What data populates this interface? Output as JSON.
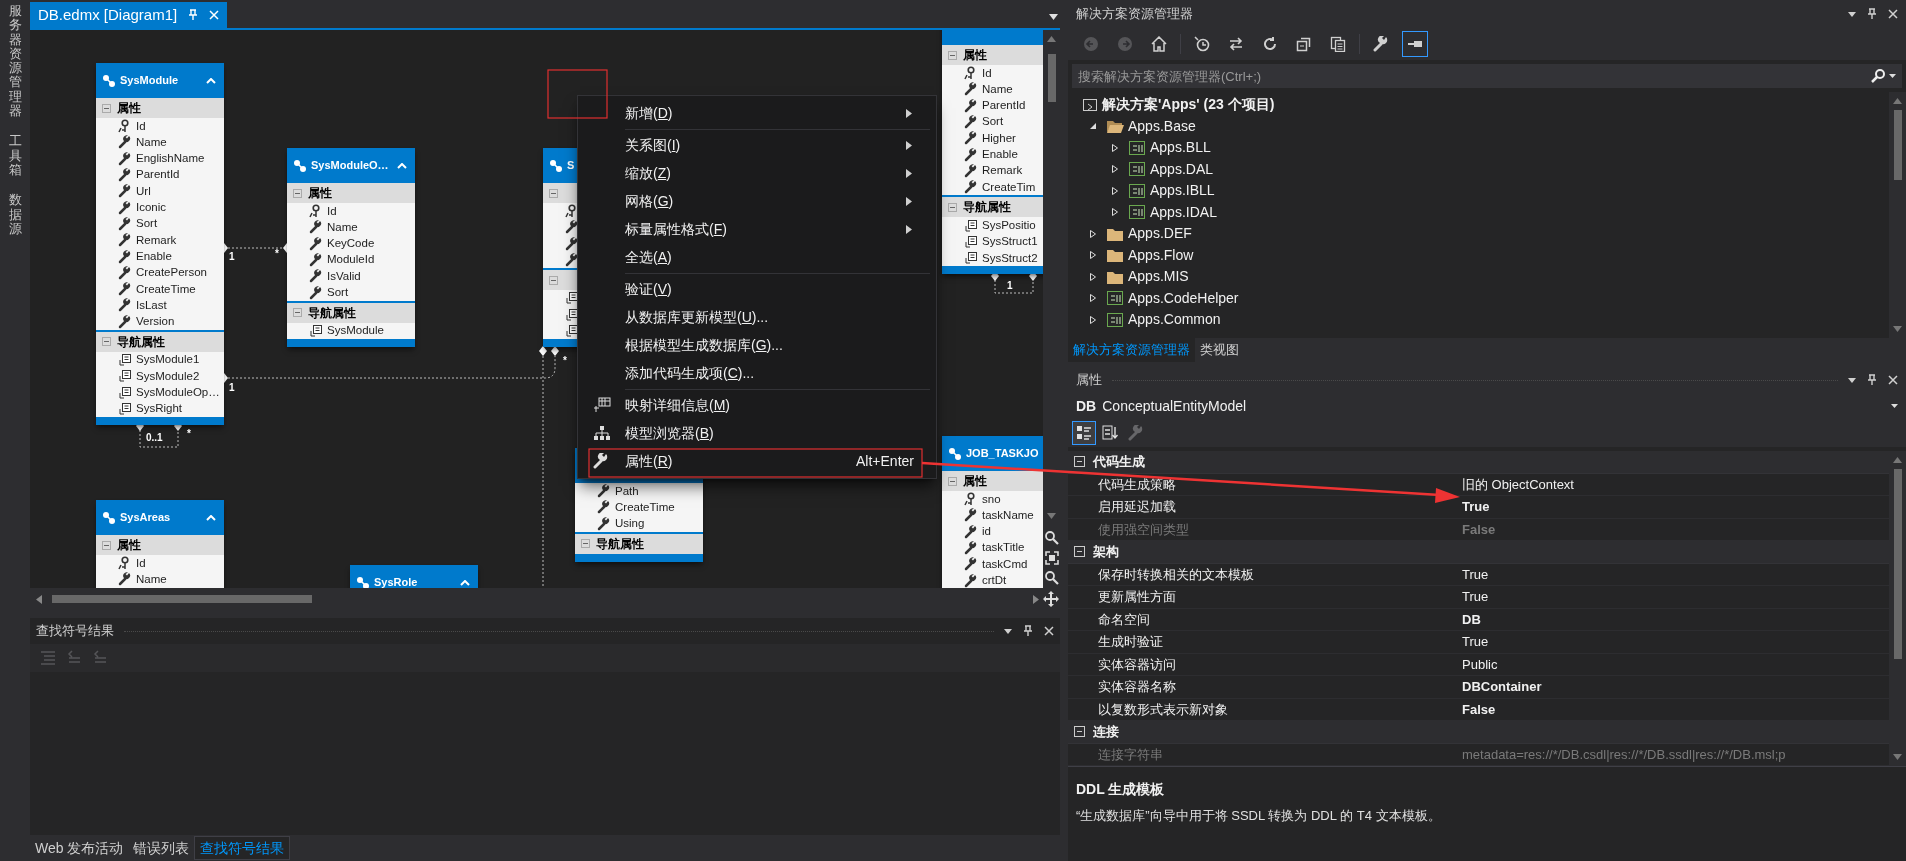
{
  "side_tabs": [
    "服务器资源管理器",
    "工具箱",
    "数据源"
  ],
  "document_tab": {
    "title": "DB.edmx [Diagram1]",
    "selected": true
  },
  "diagram": {
    "entities": [
      {
        "name": "SysModule",
        "sections": [
          {
            "label": "属性",
            "rows": [
              {
                "name": "Id",
                "kind": "key"
              },
              {
                "name": "Name",
                "kind": "property"
              },
              {
                "name": "EnglishName",
                "kind": "property"
              },
              {
                "name": "ParentId",
                "kind": "property"
              },
              {
                "name": "Url",
                "kind": "property"
              },
              {
                "name": "Iconic",
                "kind": "property"
              },
              {
                "name": "Sort",
                "kind": "property"
              },
              {
                "name": "Remark",
                "kind": "property"
              },
              {
                "name": "Enable",
                "kind": "property"
              },
              {
                "name": "CreatePerson",
                "kind": "property"
              },
              {
                "name": "CreateTime",
                "kind": "property"
              },
              {
                "name": "IsLast",
                "kind": "property"
              },
              {
                "name": "Version",
                "kind": "property"
              }
            ]
          },
          {
            "label": "导航属性",
            "rows": [
              {
                "name": "SysModule1",
                "kind": "navigation"
              },
              {
                "name": "SysModule2",
                "kind": "navigation"
              },
              {
                "name": "SysModuleOp…",
                "kind": "navigation"
              },
              {
                "name": "SysRight",
                "kind": "navigation"
              }
            ]
          }
        ]
      },
      {
        "name": "SysAreas",
        "sections": [
          {
            "label": "属性",
            "rows": [
              {
                "name": "Id",
                "kind": "key"
              },
              {
                "name": "Name",
                "kind": "property"
              }
            ]
          }
        ]
      },
      {
        "name": "SysModuleO…",
        "sections": [
          {
            "label": "属性",
            "rows": [
              {
                "name": "Id",
                "kind": "key"
              },
              {
                "name": "Name",
                "kind": "property"
              },
              {
                "name": "KeyCode",
                "kind": "property"
              },
              {
                "name": "ModuleId",
                "kind": "property"
              },
              {
                "name": "IsValid",
                "kind": "property"
              },
              {
                "name": "Sort",
                "kind": "property"
              }
            ]
          },
          {
            "label": "导航属性",
            "rows": [
              {
                "name": "SysModule",
                "kind": "navigation"
              }
            ]
          }
        ]
      },
      {
        "name": "SysRole"
      },
      {
        "name": "S",
        "sections": [
          {
            "rows": [
              {
                "kind": "key"
              },
              {
                "kind": "property"
              },
              {
                "kind": "property"
              },
              {
                "kind": "property"
              }
            ]
          },
          {
            "rows": [
              {
                "kind": "navigation"
              },
              {
                "kind": "navigation"
              },
              {
                "kind": "navigation"
              }
            ]
          }
        ]
      },
      {
        "sections": [
          {
            "rows": [
              {
                "name": "Path",
                "kind": "property"
              },
              {
                "name": "CreateTime",
                "kind": "property"
              },
              {
                "name": "Using",
                "kind": "property"
              }
            ]
          },
          {
            "label": "导航属性"
          }
        ]
      },
      {
        "sections": [
          {
            "label": "属性",
            "rows": [
              {
                "name": "Id",
                "kind": "key"
              },
              {
                "name": "Name",
                "kind": "property"
              },
              {
                "name": "ParentId",
                "kind": "property"
              },
              {
                "name": "Sort",
                "kind": "property"
              },
              {
                "name": "Higher",
                "kind": "property"
              },
              {
                "name": "Enable",
                "kind": "property"
              },
              {
                "name": "Remark",
                "kind": "property"
              },
              {
                "name": "CreateTim",
                "kind": "property"
              }
            ]
          },
          {
            "label": "导航属性",
            "rows": [
              {
                "name": "SysPositio",
                "kind": "navigation"
              },
              {
                "name": "SysStruct1",
                "kind": "navigation"
              },
              {
                "name": "SysStruct2",
                "kind": "navigation"
              }
            ]
          }
        ]
      },
      {
        "name": "JOB_TASKJO",
        "sections": [
          {
            "label": "属性",
            "rows": [
              {
                "name": "sno",
                "kind": "key"
              },
              {
                "name": "taskName",
                "kind": "property"
              },
              {
                "name": "id",
                "kind": "property"
              },
              {
                "name": "taskTitle",
                "kind": "property"
              },
              {
                "name": "taskCmd",
                "kind": "property"
              },
              {
                "name": "crtDt",
                "kind": "property"
              }
            ]
          }
        ]
      }
    ],
    "multiplicities": [
      "1",
      "*",
      "1",
      "*",
      "0..1",
      "*",
      "1"
    ]
  },
  "context_menu": {
    "items": [
      {
        "kind": "submenu",
        "label": "新增(D)"
      },
      {
        "kind": "separator"
      },
      {
        "kind": "submenu",
        "label": "关系图(I)"
      },
      {
        "kind": "submenu",
        "label": "缩放(Z)"
      },
      {
        "kind": "submenu",
        "label": "网格(G)"
      },
      {
        "kind": "submenu",
        "label": "标量属性格式(F)"
      },
      {
        "kind": "item",
        "label": "全选(A)"
      },
      {
        "kind": "separator"
      },
      {
        "kind": "item",
        "label": "验证(V)"
      },
      {
        "kind": "item",
        "label": "从数据库更新模型(U)..."
      },
      {
        "kind": "item",
        "label": "根据模型生成数据库(G)..."
      },
      {
        "kind": "item",
        "label": "添加代码生成项(C)..."
      },
      {
        "kind": "separator"
      },
      {
        "kind": "mapping",
        "label": "映射详细信息(M)"
      },
      {
        "kind": "browser",
        "label": "模型浏览器(B)"
      },
      {
        "kind": "properties",
        "label": "属性(R)",
        "shortcut": "Alt+Enter"
      }
    ]
  },
  "find_symbol_panel": {
    "title": "查找符号结果",
    "toolbar": [
      {
        "kind": "list",
        "disabled": true
      },
      {
        "kind": "previous",
        "disabled": true
      },
      {
        "kind": "next",
        "disabled": true
      }
    ]
  },
  "bottom_tabs": [
    {
      "label": "Web 发布活动",
      "selected": false
    },
    {
      "label": "错误列表",
      "selected": false
    },
    {
      "label": "查找符号结果",
      "selected": true
    }
  ],
  "solution_explorer": {
    "title": "解决方案资源管理器",
    "toolbar": [
      {
        "kind": "back",
        "disabled": true,
        "on": false
      },
      {
        "kind": "forward",
        "disabled": true,
        "on": false
      },
      {
        "kind": "home",
        "disabled": false,
        "on": false
      },
      {
        "kind": "separator"
      },
      {
        "kind": "history",
        "disabled": false,
        "on": false
      },
      {
        "kind": "sync",
        "disabled": false,
        "on": false
      },
      {
        "kind": "refresh",
        "disabled": false,
        "on": false
      },
      {
        "kind": "collapse",
        "disabled": false,
        "on": false
      },
      {
        "kind": "show-all",
        "disabled": false,
        "on": false
      },
      {
        "kind": "separator"
      },
      {
        "kind": "properties",
        "disabled": false,
        "on": false
      },
      {
        "kind": "preview",
        "disabled": false,
        "on": true
      }
    ],
    "search": {
      "placeholder": "搜索解决方案资源管理器(Ctrl+;)"
    },
    "tree": [
      {
        "kind": "solution",
        "label": "解决方案'Apps' (23 个项目)",
        "children": [
          {
            "kind": "folder",
            "label": "Apps.Base",
            "expanded": true,
            "children": [
              {
                "kind": "csproj",
                "label": "Apps.BLL",
                "expanded": false
              },
              {
                "kind": "csproj",
                "label": "Apps.DAL",
                "expanded": false
              },
              {
                "kind": "csproj",
                "label": "Apps.IBLL",
                "expanded": false
              },
              {
                "kind": "csproj",
                "label": "Apps.IDAL",
                "expanded": false
              }
            ]
          },
          {
            "kind": "folder",
            "label": "Apps.DEF",
            "expanded": false
          },
          {
            "kind": "folder",
            "label": "Apps.Flow",
            "expanded": false
          },
          {
            "kind": "folder",
            "label": "Apps.MIS",
            "expanded": false
          },
          {
            "kind": "csproj",
            "label": "Apps.CodeHelper",
            "expanded": false
          },
          {
            "kind": "csproj",
            "label": "Apps.Common",
            "expanded": false
          }
        ]
      }
    ],
    "tabs": [
      {
        "label": "解决方案资源管理器",
        "selected": true
      },
      {
        "label": "类视图",
        "selected": false
      }
    ]
  },
  "properties": {
    "title": "属性",
    "object_name": "DB",
    "object_type": "ConceptualEntityModel",
    "toolbar": [
      {
        "kind": "categorized",
        "on": true,
        "disabled": false
      },
      {
        "kind": "alphabetical",
        "on": false,
        "disabled": false
      },
      {
        "kind": "property-pages",
        "on": false,
        "disabled": true
      }
    ],
    "categories": [
      {
        "name": "代码生成",
        "expanded": true,
        "rows": [
          {
            "name": "代码生成策略",
            "value": "旧的 ObjectContext",
            "bold": false,
            "disabled": false
          },
          {
            "name": "启用延迟加载",
            "value": "True",
            "bold": true,
            "disabled": false
          },
          {
            "name": "使用强空间类型",
            "value": "False",
            "bold": true,
            "disabled": true
          }
        ]
      },
      {
        "name": "架构",
        "expanded": true,
        "rows": [
          {
            "name": "保存时转换相关的文本模板",
            "value": "True",
            "bold": false,
            "disabled": false
          },
          {
            "name": "更新属性方面",
            "value": "True",
            "bold": false,
            "disabled": false
          },
          {
            "name": "命名空间",
            "value": "DB",
            "bold": true,
            "disabled": false
          },
          {
            "name": "生成时验证",
            "value": "True",
            "bold": false,
            "disabled": false
          },
          {
            "name": "实体容器访问",
            "value": "Public",
            "bold": false,
            "disabled": false
          },
          {
            "name": "实体容器名称",
            "value": "DBContainer",
            "bold": true,
            "disabled": false
          },
          {
            "name": "以复数形式表示新对象",
            "value": "False",
            "bold": true,
            "disabled": false
          }
        ]
      },
      {
        "name": "连接",
        "expanded": true,
        "rows": [
          {
            "name": "连接字符串",
            "value": "metadata=res://*/DB.csdl|res://*/DB.ssdl|res://*/DB.msl;p",
            "bold": false,
            "disabled": true
          }
        ]
      }
    ],
    "description": {
      "title": "DDL 生成模板",
      "text": "“生成数据库”向导中用于将 SSDL 转换为 DDL 的 T4 文本模板。"
    }
  }
}
